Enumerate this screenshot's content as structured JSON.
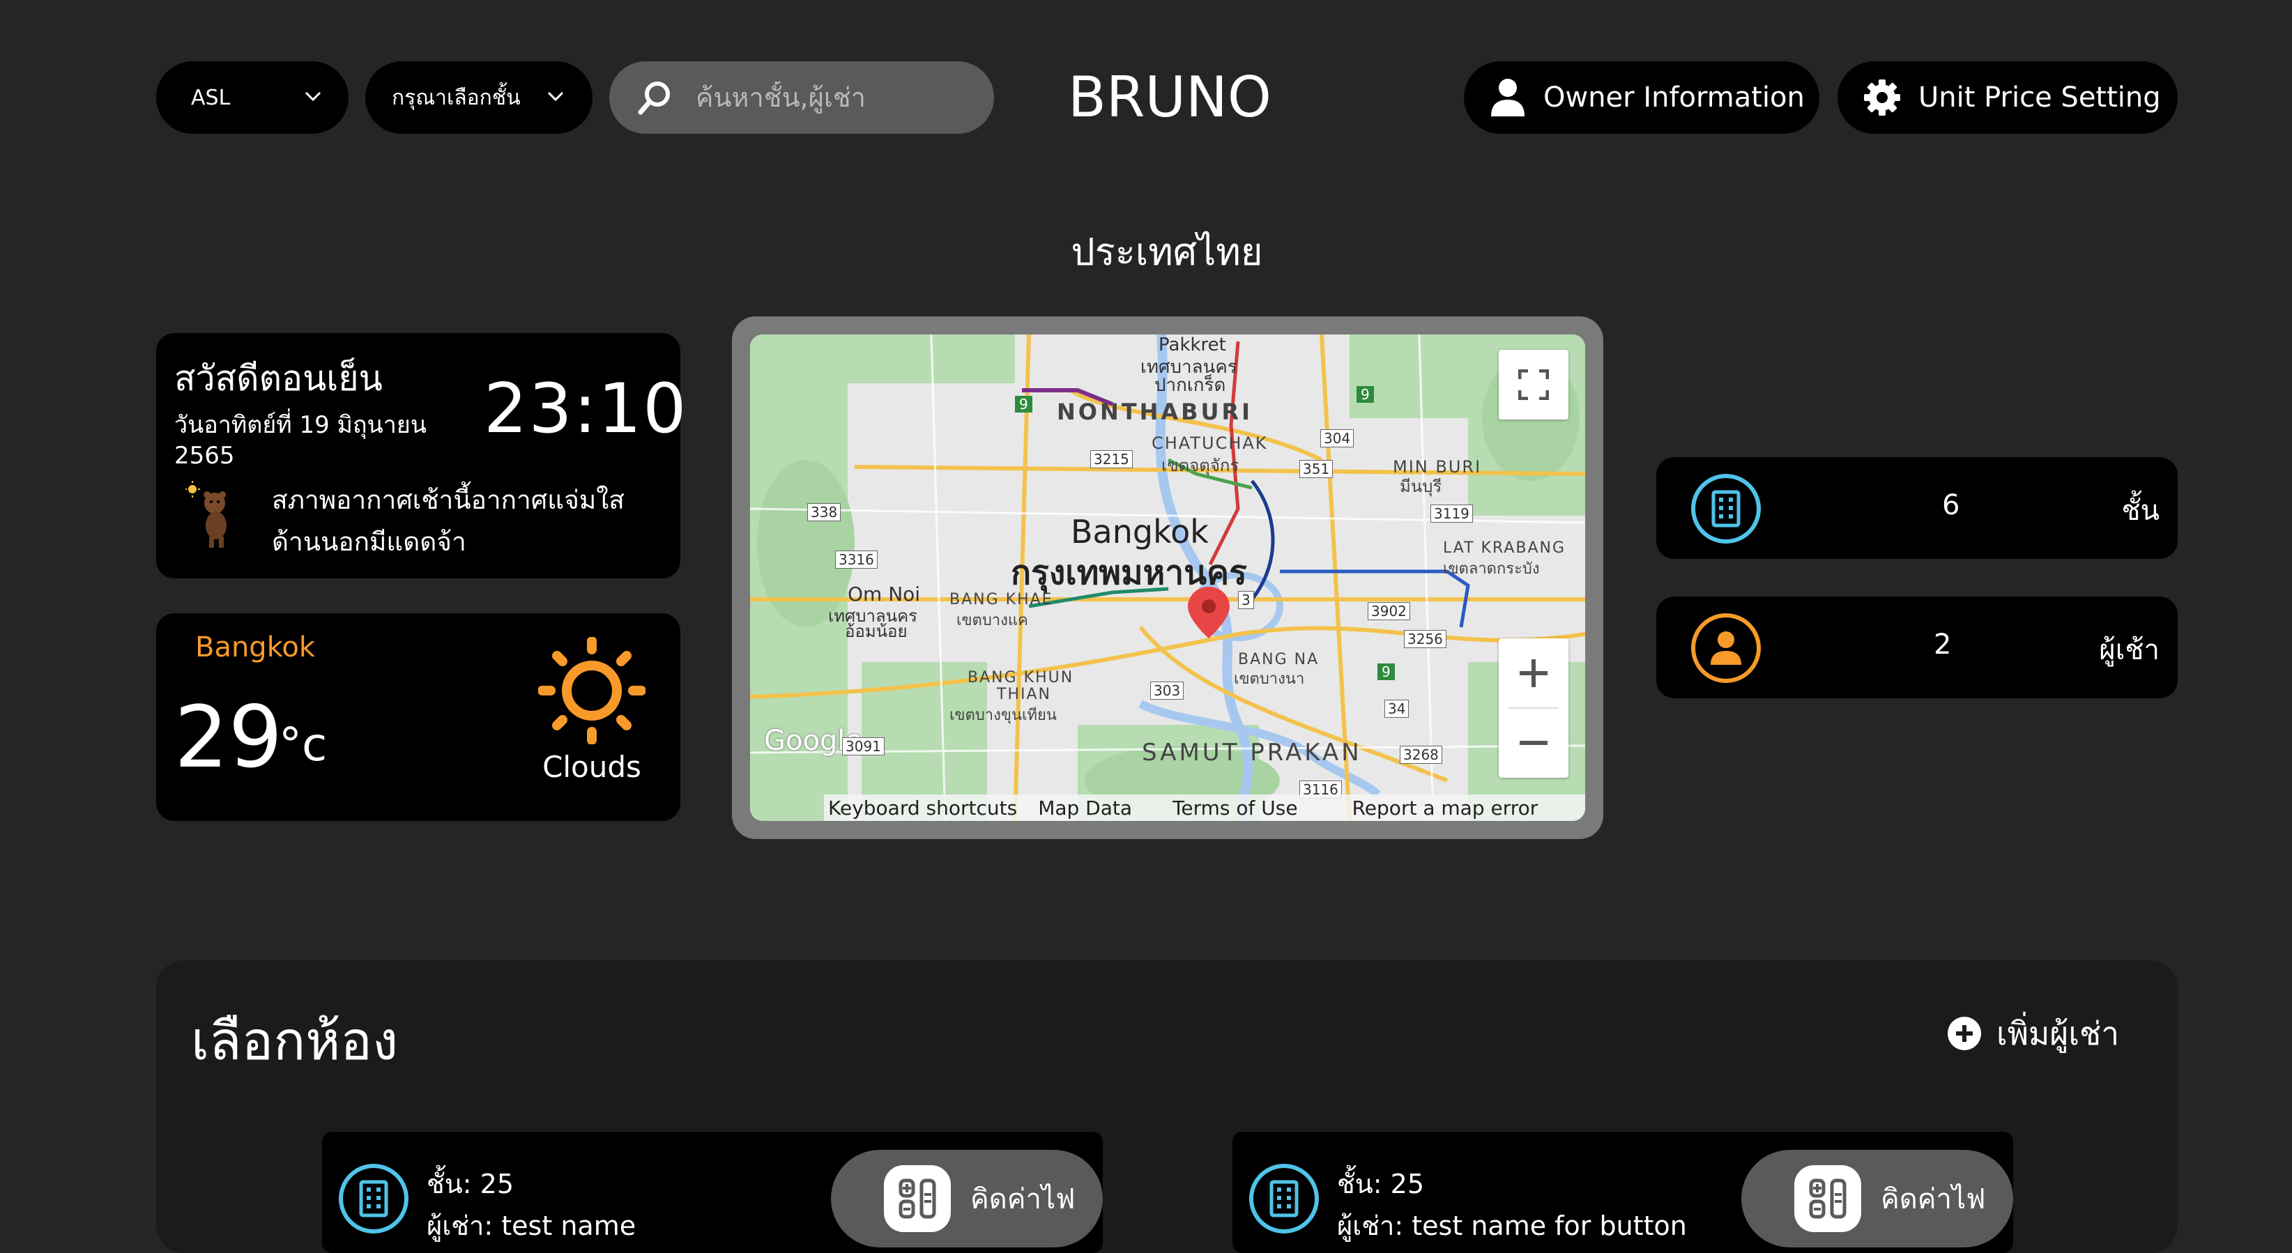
{
  "header": {
    "building_select": "ASL",
    "floor_select": "กรุณาเลือกชั้น",
    "search_placeholder": "ค้นหาชั้น,ผู้เช่า",
    "brand": "BRUNO",
    "owner_button": "Owner Information",
    "unit_price_button": "Unit Price Setting"
  },
  "country": "ประเทศไทย",
  "greeting_card": {
    "greeting": "สวัสดีตอนเย็น",
    "date_line1": "วันอาทิตย์ที่ 19 มิถุนายน",
    "date_line2": "2565",
    "time": "23:10",
    "message_line1": "สภาพอากาศเช้านี้อากาศแจ่มใส",
    "message_line2": "ด้านนอกมีแดดจ้า"
  },
  "weather_card": {
    "city": "Bangkok",
    "temperature": "29",
    "unit": "°c",
    "condition": "Clouds",
    "accent_color": "#f79a2a"
  },
  "map": {
    "labels": {
      "pakkret": "Pakkret",
      "pakkret_th": "เทศบาลนคร",
      "pakkret_th2": "ปากเกร็ด",
      "nonthaburi": "NONTHABURI",
      "chatuchak": "CHATUCHAK",
      "chatuchak_th": "เขตจตุจักร",
      "min_buri": "MIN BURI",
      "min_buri_th": "มีนบุรี",
      "bangkok": "Bangkok",
      "bangkok_th": "กรุงเทพมหานคร",
      "lat_krabang": "LAT KRABANG",
      "lat_krabang_th": "เขตลาดกระบัง",
      "om_noi": "Om Noi",
      "om_noi_th": "เทศบาลนคร",
      "om_noi_th2": "อ้อมน้อย",
      "bang_khae": "BANG KHAE",
      "bang_khae_th": "เขตบางแค",
      "bang_na": "BANG NA",
      "bang_na_th": "เขตบางนา",
      "bang_khun": "BANG KHUN",
      "thian": "THIAN",
      "bang_khun_th": "เขตบางขุนเทียน",
      "samut_prakan": "SAMUT PRAKAN",
      "google": "Google",
      "road_9a": "9",
      "road_9b": "9",
      "road_9c": "9",
      "road_304": "304",
      "road_3215": "3215",
      "road_351": "351",
      "road_338": "338",
      "road_3119": "3119",
      "road_3316": "3316",
      "road_3": "3",
      "road_3902": "3902",
      "road_3256": "3256",
      "road_303": "303",
      "road_34": "34",
      "road_3268": "3268",
      "road_3116": "3116",
      "road_3091": "3091"
    },
    "footer": {
      "keyboard": "Keyboard shortcuts",
      "map_data": "Map Data",
      "terms": "Terms of Use",
      "report": "Report a map error"
    }
  },
  "stats": [
    {
      "value": "6",
      "label": "ชั้น",
      "icon": "building-icon",
      "color": "#4fc3e8"
    },
    {
      "value": "2",
      "label": "ผู้เช้า",
      "icon": "person-icon",
      "color": "#f79a2a"
    }
  ],
  "rooms_section": {
    "title": "เลือกห้อง",
    "add_button": "เพิ่มผู้เช่า",
    "rooms": [
      {
        "floor": "ชั้น: 25",
        "tenant": "ผู้เช่า: test name",
        "action": "คิดค่าไฟ"
      },
      {
        "floor": "ชั้น: 25",
        "tenant": "ผู้เช่า: test name for button",
        "action": "คิดค่าไฟ"
      }
    ]
  }
}
